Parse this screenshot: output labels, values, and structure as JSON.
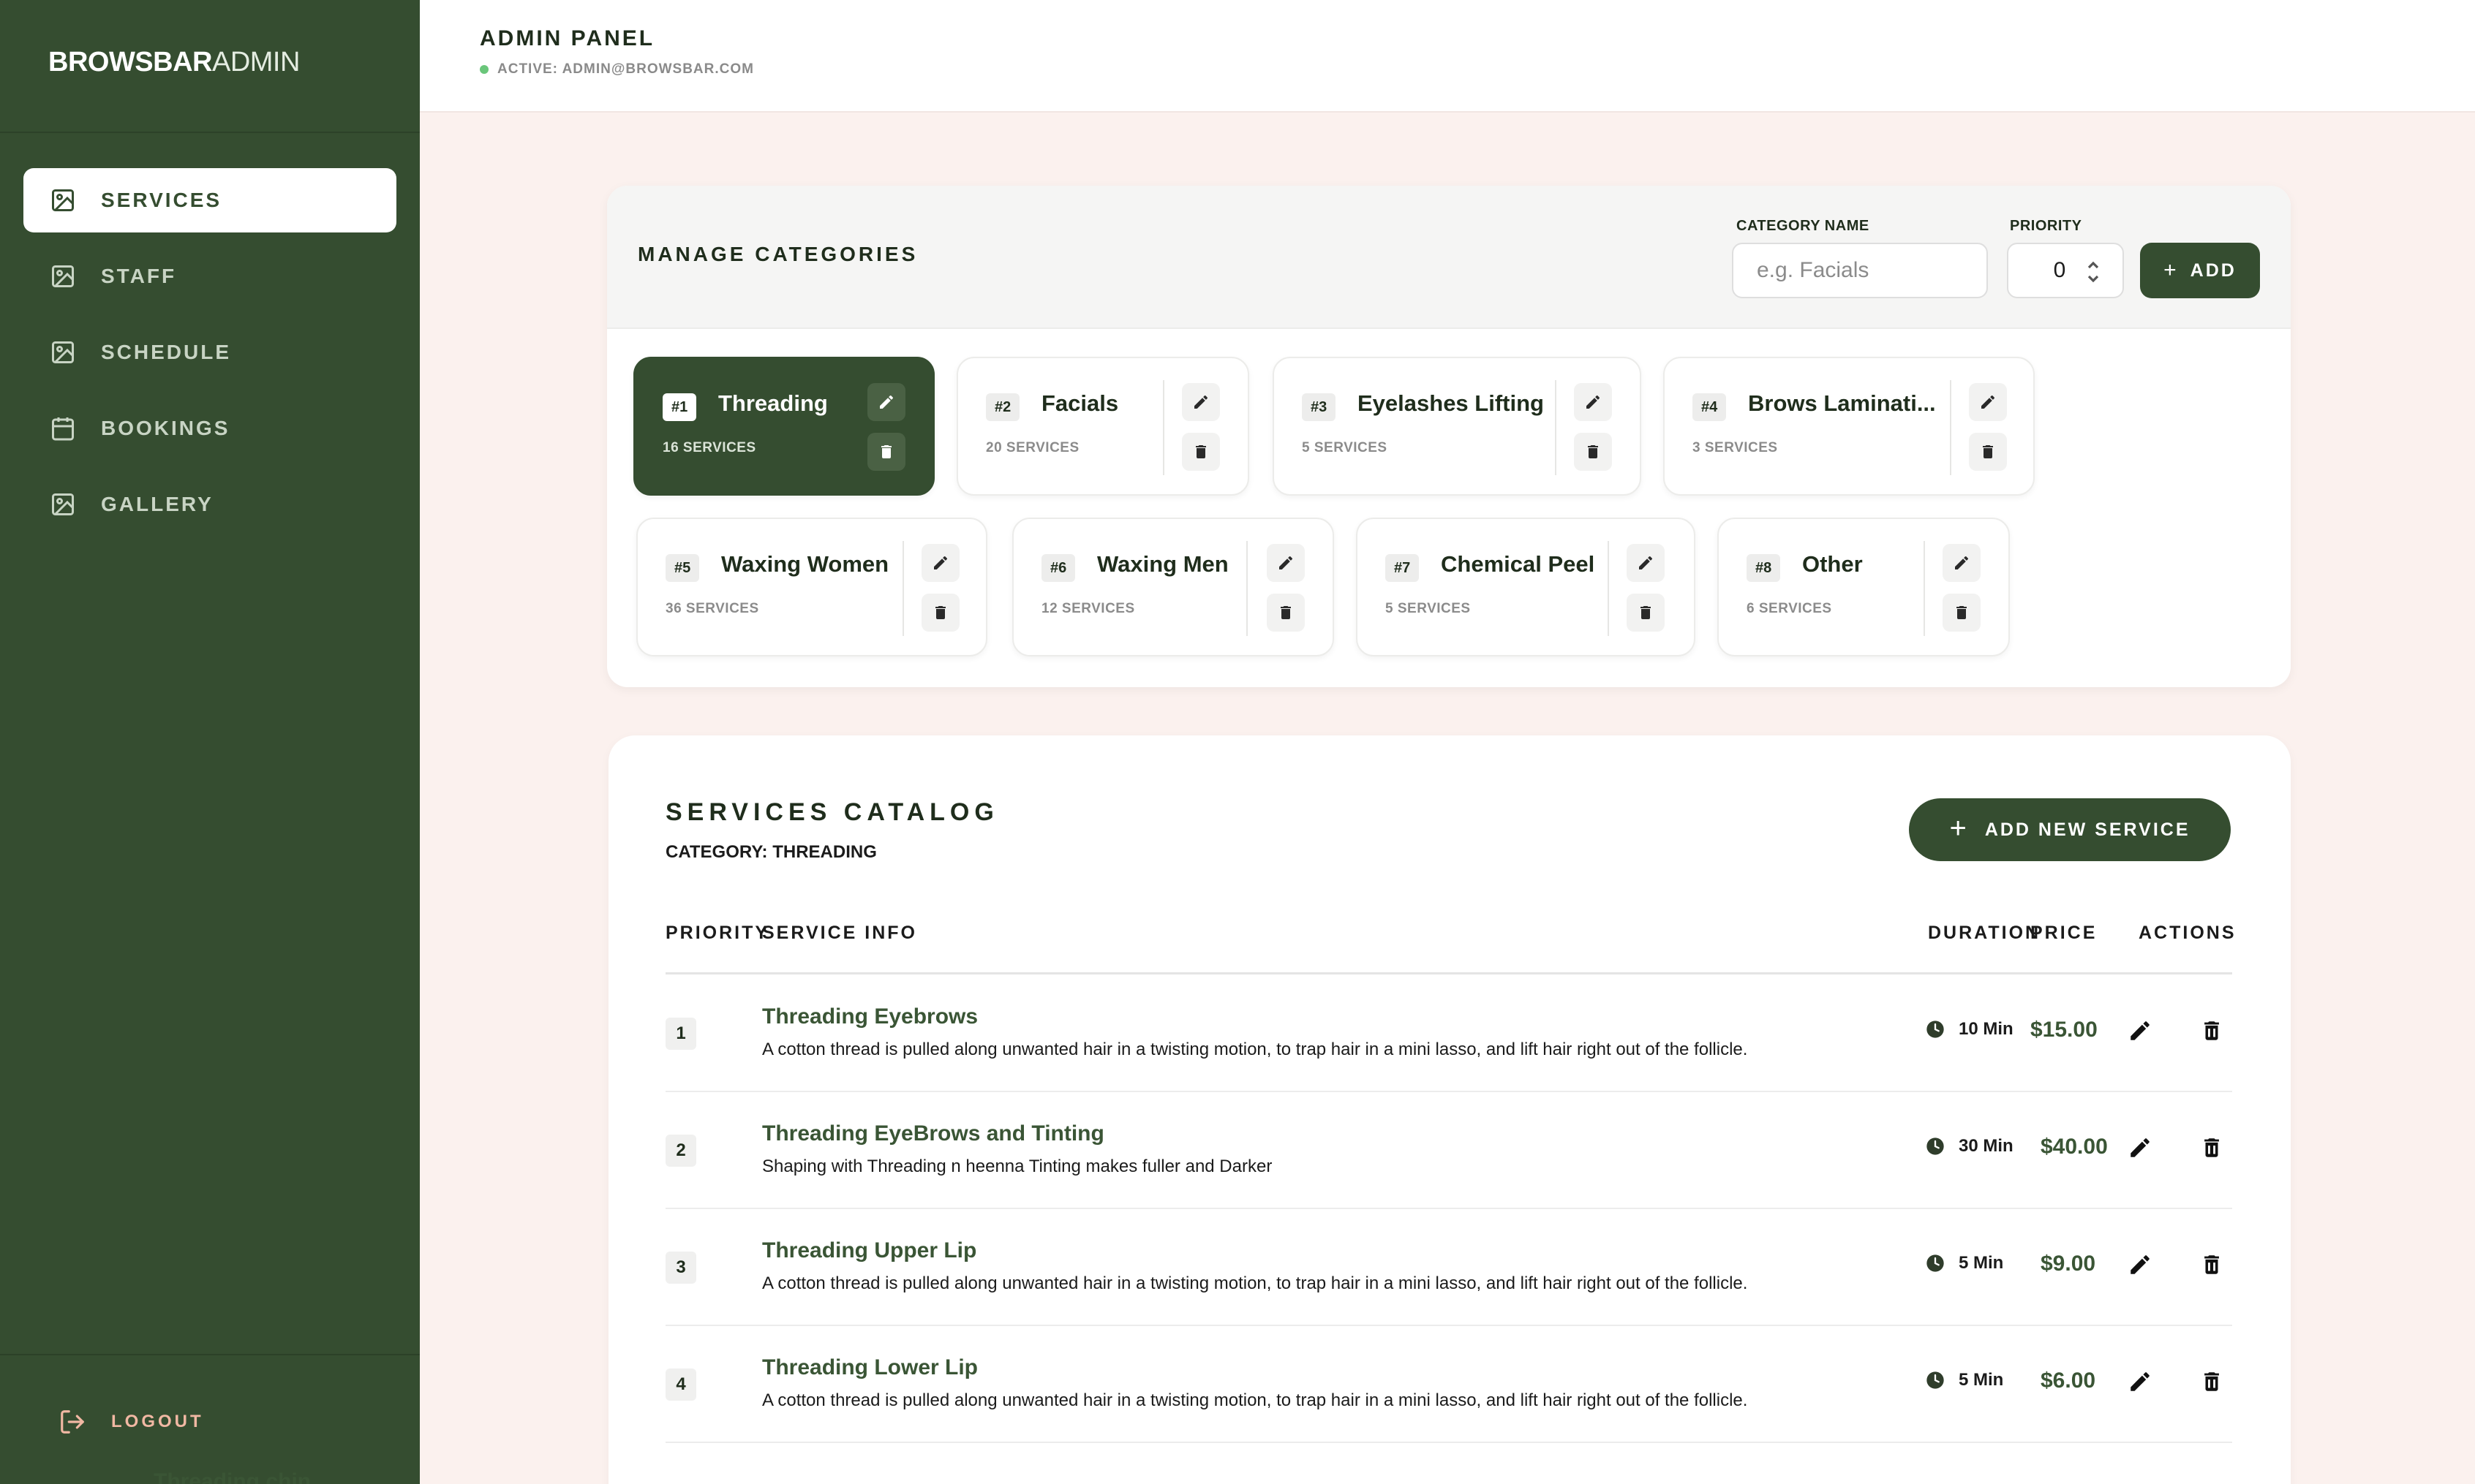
{
  "brand": {
    "bold": "BROWSBAR",
    "light": "ADMIN"
  },
  "nav": [
    {
      "label": "SERVICES",
      "icon": "image-icon",
      "active": true
    },
    {
      "label": "STAFF",
      "icon": "image-icon",
      "active": false
    },
    {
      "label": "SCHEDULE",
      "icon": "image-icon",
      "active": false
    },
    {
      "label": "BOOKINGS",
      "icon": "calendar-icon",
      "active": false
    },
    {
      "label": "GALLERY",
      "icon": "image-icon",
      "active": false
    }
  ],
  "logout_label": "LOGOUT",
  "header": {
    "title": "ADMIN PANEL",
    "status": "ACTIVE: ADMIN@BROWSBAR.COM"
  },
  "categories": {
    "title": "MANAGE CATEGORIES",
    "name_label": "CATEGORY NAME",
    "name_placeholder": "e.g. Facials",
    "priority_label": "PRIORITY",
    "priority_value": "0",
    "add_label": "ADD",
    "items": [
      {
        "num": "#1",
        "name": "Threading",
        "count": "16 SERVICES",
        "active": true
      },
      {
        "num": "#2",
        "name": "Facials",
        "count": "20 SERVICES"
      },
      {
        "num": "#3",
        "name": "Eyelashes Lifting",
        "count": "5 SERVICES"
      },
      {
        "num": "#4",
        "name": "Brows Laminati...",
        "count": "3 SERVICES"
      },
      {
        "num": "#5",
        "name": "Waxing Women",
        "count": "36 SERVICES"
      },
      {
        "num": "#6",
        "name": "Waxing Men",
        "count": "12 SERVICES"
      },
      {
        "num": "#7",
        "name": "Chemical Peel",
        "count": "5 SERVICES"
      },
      {
        "num": "#8",
        "name": "Other",
        "count": "6 SERVICES"
      }
    ]
  },
  "catalog": {
    "title": "SERVICES CATALOG",
    "subtitle": "CATEGORY: THREADING",
    "add_label": "ADD NEW SERVICE",
    "columns": {
      "priority": "PRIORITY",
      "info": "SERVICE INFO",
      "duration": "DURATION",
      "price": "PRICE",
      "actions": "ACTIONS"
    },
    "rows": [
      {
        "priority": "1",
        "name": "Threading Eyebrows",
        "desc": "A cotton thread is pulled along unwanted hair in a twisting motion, to trap hair in a mini lasso, and lift hair right out of the follicle.",
        "duration": "10 Min",
        "price": "$15.00"
      },
      {
        "priority": "2",
        "name": "Threading EyeBrows and Tinting",
        "desc": "Shaping with Threading n heenna Tinting makes fuller and Darker",
        "duration": "30 Min",
        "price": "$40.00"
      },
      {
        "priority": "3",
        "name": "Threading Upper Lip",
        "desc": "A cotton thread is pulled along unwanted hair in a twisting motion, to trap hair in a mini lasso, and lift hair right out of the follicle.",
        "duration": "5 Min",
        "price": "$9.00"
      },
      {
        "priority": "4",
        "name": "Threading Lower Lip",
        "desc": "A cotton thread is pulled along unwanted hair in a twisting motion, to trap hair in a mini lasso, and lift hair right out of the follicle.",
        "duration": "5 Min",
        "price": "$6.00"
      }
    ],
    "partial_row_name": "Threading chin"
  }
}
